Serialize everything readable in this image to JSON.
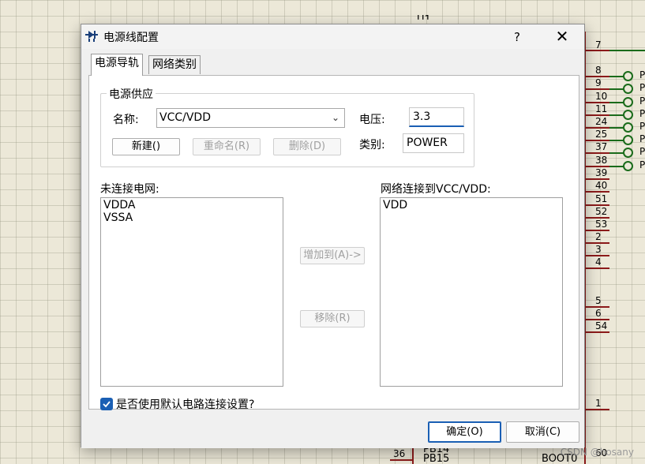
{
  "dialog": {
    "title": "电源线配置",
    "help_label": "?",
    "close_label": "✕",
    "tabs": [
      {
        "label": "电源导轨"
      },
      {
        "label": "网络类别"
      }
    ],
    "power_supply": {
      "group_title": "电源供应",
      "name_label": "名称:",
      "name_value": "VCC/VDD",
      "voltage_label": "电压:",
      "voltage_value": "3.3",
      "type_label": "类别:",
      "type_value": "POWER",
      "new_button": "新建()",
      "rename_button": "重命名(R)",
      "delete_button": "删除(D)"
    },
    "unconnected_label": "未连接电网:",
    "unconnected_nets": [
      "VDDA",
      "VSSA"
    ],
    "connected_label": "网络连接到VCC/VDD:",
    "connected_nets": [
      "VDD"
    ],
    "add_button": "增加到(A)->",
    "remove_button": "移除(R)",
    "default_checkbox_label": "是否使用默认电路连接设置?",
    "ok_button": "确定(O)",
    "cancel_button": "取消(C)"
  },
  "schematic": {
    "top_partial_label": "U1",
    "pin_numbers": [
      "7",
      "8",
      "9",
      "10",
      "11",
      "24",
      "25",
      "37",
      "38",
      "39",
      "40",
      "51",
      "52",
      "53",
      "2",
      "3",
      "4",
      "5",
      "6",
      "54",
      "1",
      "60"
    ],
    "green_pin_label": "P",
    "bottom_pin_36": "36",
    "bottom_label_pb14": "PB14",
    "bottom_label_pb15": "PB15",
    "bottom_label_boot0": "BOOT0"
  },
  "watermark": "CSDN @hosany",
  "colors": {
    "accent": "#1a5fb4",
    "pin_red": "#8b1a1a",
    "pin_green": "#1a6b1a"
  }
}
